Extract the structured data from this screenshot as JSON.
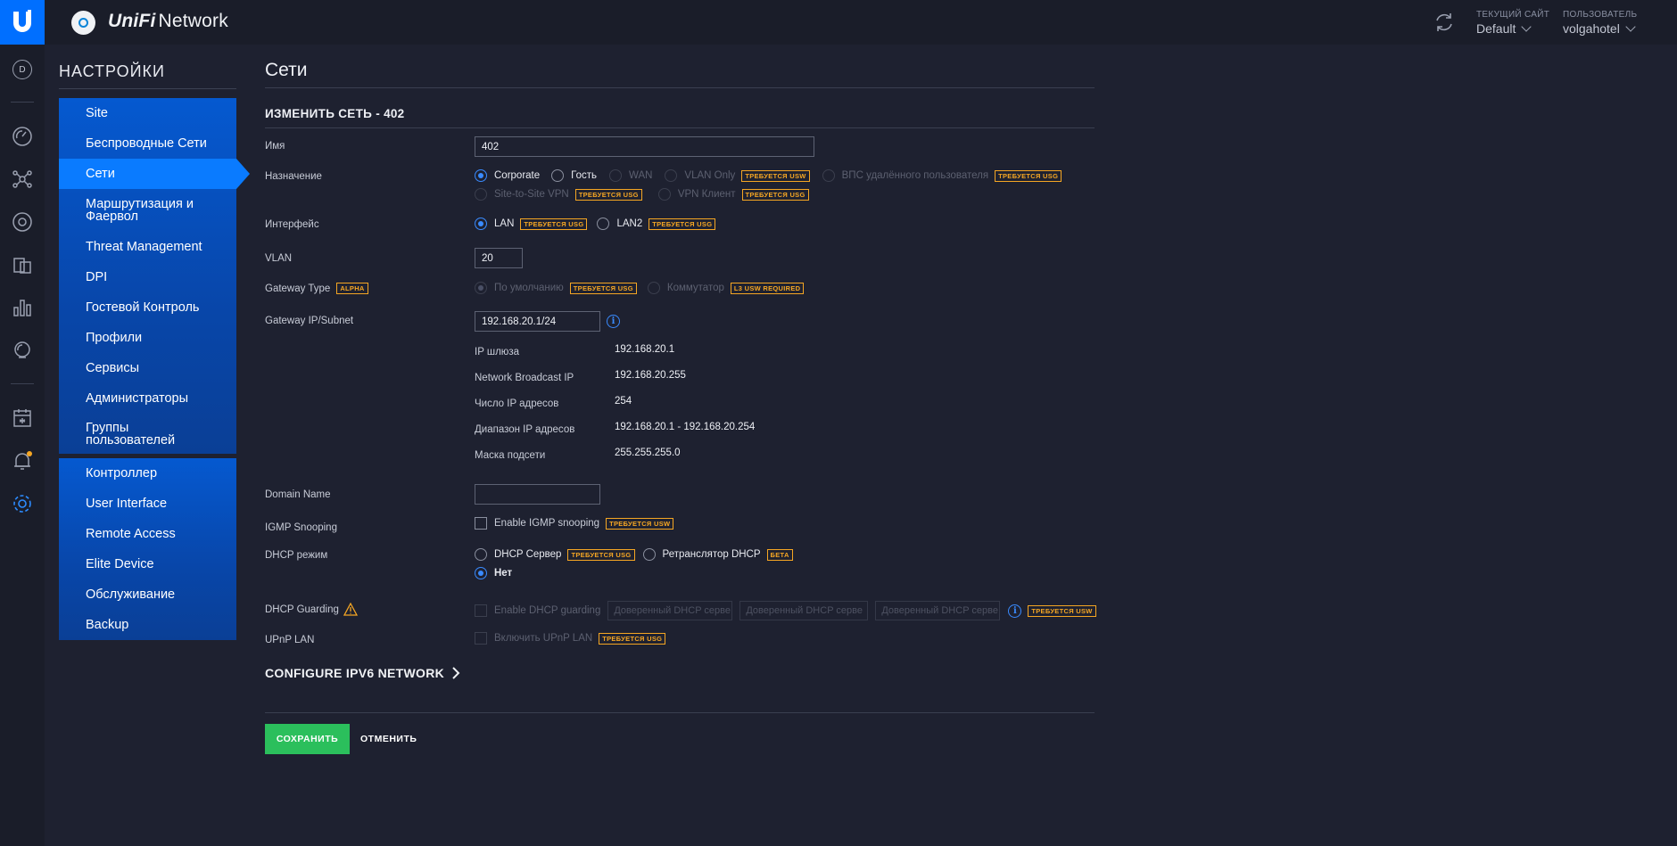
{
  "header": {
    "app_name_brand": "UniFi",
    "app_name_rest": "Network",
    "site_label": "ТЕКУЩИЙ САЙТ",
    "site_value": "Default",
    "user_label": "ПОЛЬЗОВАТЕЛЬ",
    "user_value": "volgahotel"
  },
  "rail": {
    "avatar_letter": "D"
  },
  "nav": {
    "title": "НАСТРОЙКИ",
    "group1": [
      "Site",
      "Беспроводные Сети",
      "Сети",
      "Маршрутизация и Фаервол",
      "Threat Management",
      "DPI",
      "Гостевой Контроль",
      "Профили",
      "Сервисы",
      "Администраторы",
      "Группы пользователей"
    ],
    "group2": [
      "Контроллер",
      "User Interface",
      "Remote Access",
      "Elite Device",
      "Обслуживание",
      "Backup"
    ],
    "active": "Сети"
  },
  "main": {
    "page_title": "Сети",
    "section_title": "ИЗМЕНИТЬ СЕТЬ - 402",
    "name_label": "Имя",
    "name_value": "402",
    "purpose_label": "Назначение",
    "purpose_options": {
      "corporate": "Corporate",
      "guest": "Гость",
      "wan": "WAN",
      "vlan_only": "VLAN Only",
      "vpn_remote": "ВПС удалённого пользователя",
      "site_to_site": "Site-to-Site VPN",
      "vpn_client": "VPN Клиент"
    },
    "interface_label": "Интерфейс",
    "interface_options": {
      "lan": "LAN",
      "lan2": "LAN2"
    },
    "vlan_label": "VLAN",
    "vlan_value": "20",
    "gateway_type_label": "Gateway Type",
    "gateway_type_badge": "ALPHA",
    "gateway_type_options": {
      "default": "По умолчанию",
      "switch": "Коммутатор"
    },
    "gateway_ip_label": "Gateway IP/Subnet",
    "gateway_ip_value": "192.168.20.1/24",
    "info": {
      "gateway_ip_k": "IP шлюза",
      "gateway_ip_v": "192.168.20.1",
      "broadcast_k": "Network Broadcast IP",
      "broadcast_v": "192.168.20.255",
      "count_k": "Число IP адресов",
      "count_v": "254",
      "range_k": "Диапазон IP адресов",
      "range_v": "192.168.20.1 - 192.168.20.254",
      "mask_k": "Маска подсети",
      "mask_v": "255.255.255.0"
    },
    "domain_label": "Domain Name",
    "domain_value": "",
    "igmp_label": "IGMP Snooping",
    "igmp_option": "Enable IGMP snooping",
    "dhcp_mode_label": "DHCP режим",
    "dhcp_mode_options": {
      "server": "DHCP Сервер",
      "relay": "Ретранслятор DHCP",
      "none": "Нет"
    },
    "dhcp_guard_label": "DHCP Guarding",
    "dhcp_guard_option": "Enable DHCP guarding",
    "dhcp_guard_placeholder": "Доверенный DHCP серве",
    "upnp_label": "UPnP LAN",
    "upnp_option": "Включить UPnP LAN",
    "ipv6_link": "CONFIGURE IPV6 NETWORK",
    "save_button": "СОХРАНИТЬ",
    "cancel_button": "ОТМЕНИТЬ"
  },
  "badges": {
    "usg": "ТРЕБУЕТСЯ USG",
    "usw": "ТРЕБУЕТСЯ USW",
    "l3": "L3 USW REQUIRED",
    "beta": "БЕТА"
  },
  "colors": {
    "accent": "#006fff",
    "nav_active": "#0a7bff",
    "save": "#2bbf5c",
    "badge": "#f5a623",
    "background": "#1e2130"
  }
}
